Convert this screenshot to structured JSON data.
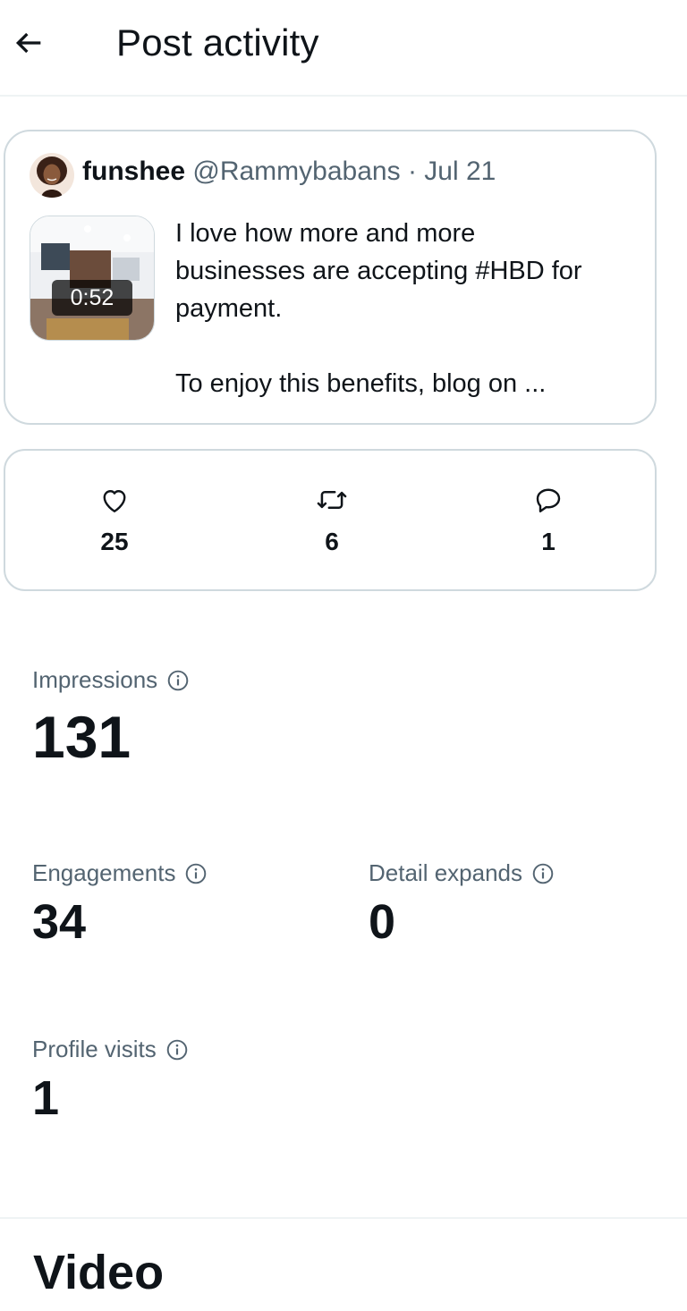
{
  "header": {
    "title": "Post activity",
    "back_icon": "arrow-left-icon"
  },
  "post": {
    "author_name": "funshee",
    "author_handle": "@Rammybabans",
    "separator": "·",
    "date": "Jul 21",
    "media_duration": "0:52",
    "text_lines": [
      "I love how more and more",
      "businesses are accepting #HBD for",
      "payment.",
      "To enjoy this benefits, blog on ..."
    ]
  },
  "engagement": {
    "likes": {
      "icon": "heart-icon",
      "count": "25"
    },
    "reposts": {
      "icon": "repost-icon",
      "count": "6"
    },
    "replies": {
      "icon": "reply-icon",
      "count": "1"
    }
  },
  "metrics": {
    "impressions": {
      "label": "Impressions",
      "value": "131"
    },
    "engagements": {
      "label": "Engagements",
      "value": "34"
    },
    "detail_expands": {
      "label": "Detail expands",
      "value": "0"
    },
    "profile_visits": {
      "label": "Profile visits",
      "value": "1"
    }
  },
  "sections": {
    "video_title": "Video"
  },
  "colors": {
    "text_primary": "#0f1419",
    "text_secondary": "#536471",
    "border": "#cfd9de",
    "divider": "#eff3f4"
  }
}
